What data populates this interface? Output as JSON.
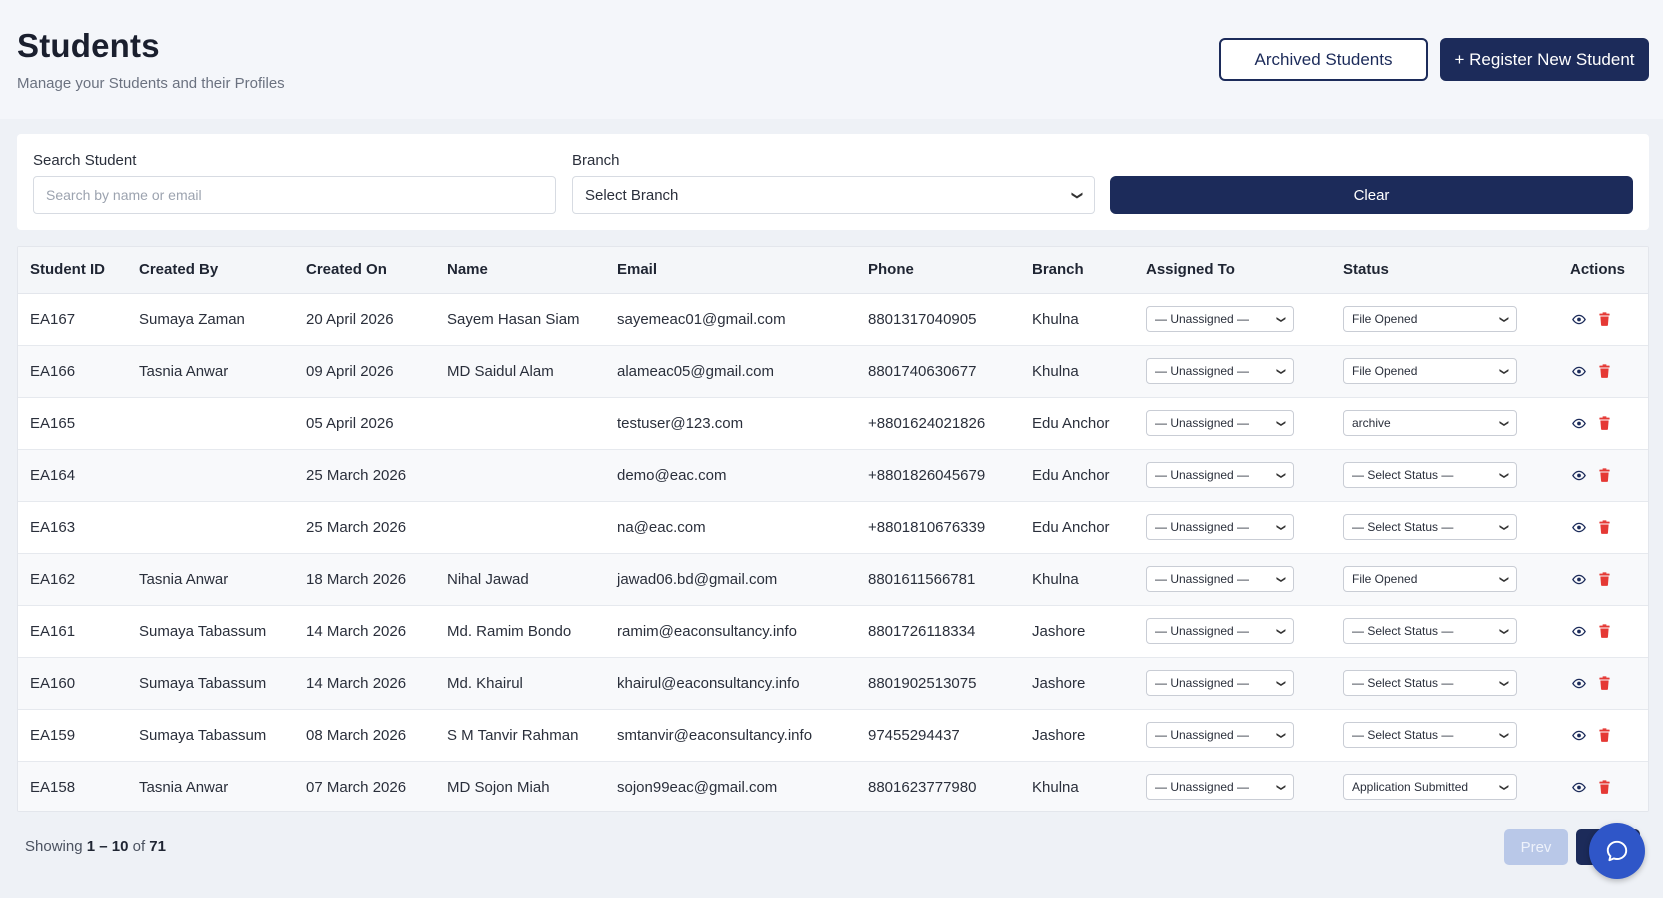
{
  "header": {
    "title": "Students",
    "subtitle": "Manage your Students and their Profiles",
    "archived_label": "Archived Students",
    "register_label": "+ Register New Student"
  },
  "filters": {
    "search_label": "Search Student",
    "search_placeholder": "Search by name or email",
    "search_value": "",
    "branch_label": "Branch",
    "branch_value": "Select Branch",
    "clear_label": "Clear"
  },
  "table": {
    "columns": [
      "Student ID",
      "Created By",
      "Created On",
      "Name",
      "Email",
      "Phone",
      "Branch",
      "Assigned To",
      "Status",
      "Actions"
    ],
    "rows": [
      {
        "id": "EA167",
        "created_by": "Sumaya Zaman",
        "created_on": "20 April 2026",
        "name": "Sayem Hasan Siam",
        "email": "sayemeac01@gmail.com",
        "phone": "8801317040905",
        "branch": "Khulna",
        "assigned": "— Unassigned —",
        "status": "File Opened"
      },
      {
        "id": "EA166",
        "created_by": "Tasnia Anwar",
        "created_on": "09 April 2026",
        "name": "MD Saidul Alam",
        "email": "alameac05@gmail.com",
        "phone": "8801740630677",
        "branch": "Khulna",
        "assigned": "— Unassigned —",
        "status": "File Opened"
      },
      {
        "id": "EA165",
        "created_by": "",
        "created_on": "05 April 2026",
        "name": "",
        "email": "testuser@123.com",
        "phone": "+8801624021826",
        "branch": "Edu Anchor",
        "assigned": "— Unassigned —",
        "status": "archive"
      },
      {
        "id": "EA164",
        "created_by": "",
        "created_on": "25 March 2026",
        "name": "",
        "email": "demo@eac.com",
        "phone": "+8801826045679",
        "branch": "Edu Anchor",
        "assigned": "— Unassigned —",
        "status": "— Select Status —"
      },
      {
        "id": "EA163",
        "created_by": "",
        "created_on": "25 March 2026",
        "name": "",
        "email": "na@eac.com",
        "phone": "+8801810676339",
        "branch": "Edu Anchor",
        "assigned": "— Unassigned —",
        "status": "— Select Status —"
      },
      {
        "id": "EA162",
        "created_by": "Tasnia Anwar",
        "created_on": "18 March 2026",
        "name": "Nihal Jawad",
        "email": "jawad06.bd@gmail.com",
        "phone": "8801611566781",
        "branch": "Khulna",
        "assigned": "— Unassigned —",
        "status": "File Opened"
      },
      {
        "id": "EA161",
        "created_by": "Sumaya Tabassum",
        "created_on": "14 March 2026",
        "name": "Md. Ramim Bondo",
        "email": "ramim@eaconsultancy.info",
        "phone": "8801726118334",
        "branch": "Jashore",
        "assigned": "— Unassigned —",
        "status": "— Select Status —"
      },
      {
        "id": "EA160",
        "created_by": "Sumaya Tabassum",
        "created_on": "14 March 2026",
        "name": "Md. Khairul",
        "email": "khairul@eaconsultancy.info",
        "phone": "8801902513075",
        "branch": "Jashore",
        "assigned": "— Unassigned —",
        "status": "— Select Status —"
      },
      {
        "id": "EA159",
        "created_by": "Sumaya Tabassum",
        "created_on": "08 March 2026",
        "name": "S M Tanvir Rahman",
        "email": "smtanvir@eaconsultancy.info",
        "phone": "97455294437",
        "branch": "Jashore",
        "assigned": "— Unassigned —",
        "status": "— Select Status —"
      },
      {
        "id": "EA158",
        "created_by": "Tasnia Anwar",
        "created_on": "07 March 2026",
        "name": "MD Sojon Miah",
        "email": "sojon99eac@gmail.com",
        "phone": "8801623777980",
        "branch": "Khulna",
        "assigned": "— Unassigned —",
        "status": "Application Submitted"
      }
    ]
  },
  "pagination": {
    "showing_prefix": "Showing",
    "range": "1 – 10",
    "of_word": "of",
    "total": "71",
    "prev_label": "Prev"
  },
  "icons": {
    "view": "eye-icon",
    "delete": "trash-icon",
    "chat": "chat-icon"
  },
  "colors": {
    "primary": "#1c2b5a",
    "delete": "#e53935",
    "view": "#1c2b5a",
    "chat": "#2f56c8",
    "prev_disabled": "#b9c8e8"
  }
}
